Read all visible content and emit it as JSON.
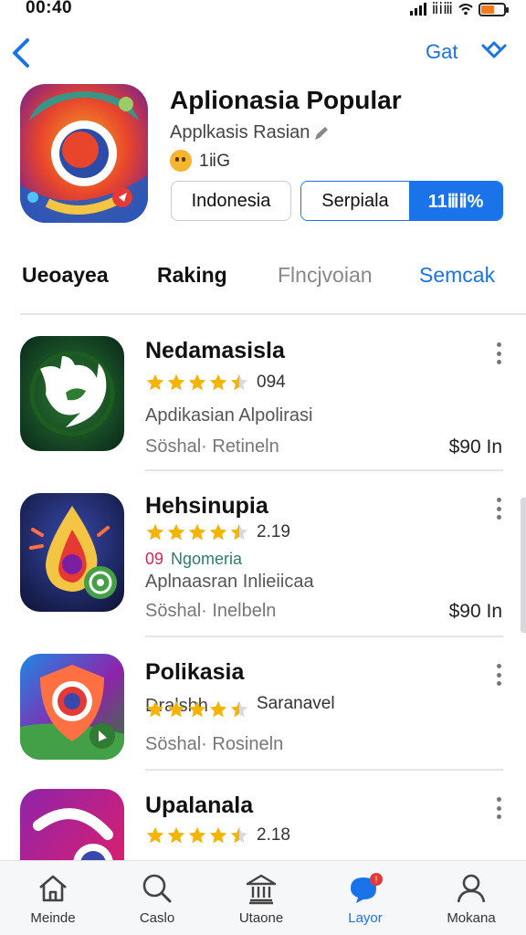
{
  "status_bar": {
    "time": "00:40",
    "carrier": "ⅱⅰⅲ"
  },
  "nav": {
    "get_label": "Gat"
  },
  "app": {
    "title": "Aplionasia Popular",
    "subtitle": "Applkasis Rasian",
    "rating_count": "1ⅱG",
    "lang_button": "Indonesia",
    "secondary_button": "Serpiala",
    "primary_button": "11ⅲⅱ%"
  },
  "tabs": [
    "Ueoayea",
    "Raking",
    "Flncjvoian",
    "Semcak"
  ],
  "list": [
    {
      "name": "Nedamasisla",
      "stars": 4.5,
      "rating_text": "094",
      "line1": "Apdikasian Alpolirasi",
      "line2": "Söshal· Retineln",
      "price": "$90 In"
    },
    {
      "name": "Hehsinupia",
      "stars": 4.5,
      "rating_text": "2.19",
      "badge_prefix": "09",
      "badge_text": "Ngomeria",
      "line1": "Aplnaasran Inlieiicaa",
      "line2": "Söshal· Inelbeln",
      "price": "$90 In"
    },
    {
      "name": "Polikasia",
      "stars": 4.5,
      "overlay_text": "Dralshh",
      "rating_text": "Saranavel",
      "line2": "Söshal· Rosineln"
    },
    {
      "name": "Upalanala",
      "stars": 4.5,
      "rating_text": "2.18"
    }
  ],
  "bottom_nav": [
    "Meinde",
    "Caslo",
    "Utaone",
    "Layor",
    "Mokana"
  ],
  "colors": {
    "accent": "#1a73e8",
    "star": "#f4b400"
  }
}
